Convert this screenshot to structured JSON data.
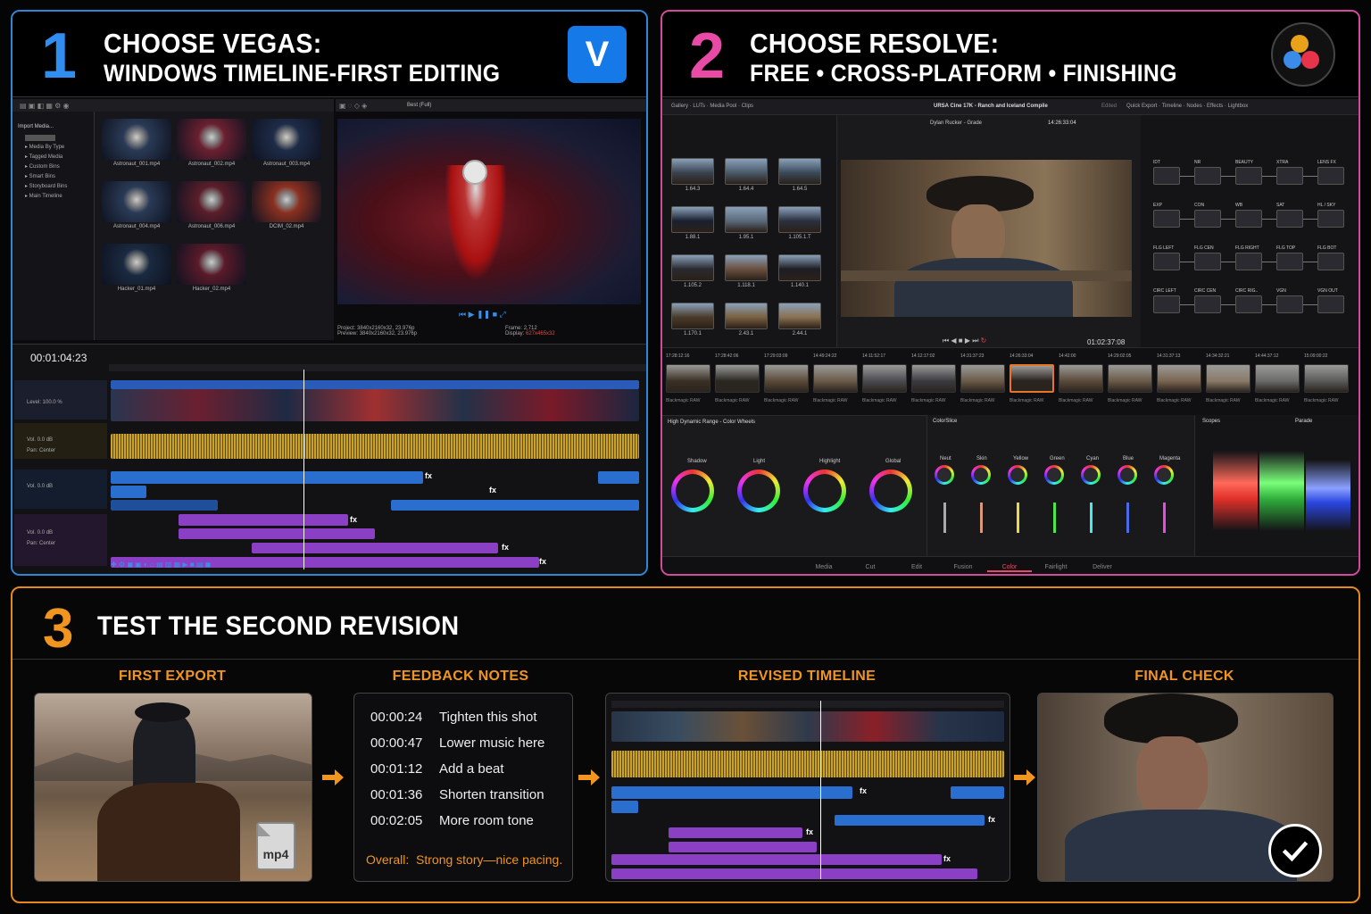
{
  "panel1": {
    "number": "1",
    "title": "CHOOSE VEGAS:",
    "subtitle": "WINDOWS TIMELINE-FIRST EDITING",
    "logo_letter": "V",
    "explorer": {
      "header": "Import Media...",
      "folders": [
        "Media By Type",
        "Tagged Media",
        "Custom Bins",
        "Smart Bins",
        "Storyboard Bins",
        "Main Timeline"
      ]
    },
    "clips": [
      "Astronaut_001.mp4",
      "Astronaut_002.mp4",
      "Astronaut_003.mp4",
      "Astronaut_004.mp4",
      "Astronaut_006.mp4",
      "DCIM_02.mp4",
      "Hacker_01.mp4",
      "Hacker_02.mp4"
    ],
    "preview_quality": "Best (Full)",
    "project_label": "Project:",
    "project_value": "3840x2160x32, 23.976p",
    "preview_label": "Preview:",
    "preview_value": "3840x2160x32, 23.976p",
    "frame_label": "Frame:",
    "frame_value": "2,712",
    "display_label": "Display:",
    "display_value": "627x465x32",
    "timecode": "00:01:04:23",
    "video_track_level": "Level: 100.0 %",
    "audio_vol": "Vol.",
    "audio_vol_value": "0.0 dB",
    "audio_pan": "Pan:",
    "audio_pan_value": "Center",
    "fx_label": "fx"
  },
  "panel2": {
    "number": "2",
    "title": "CHOOSE RESOLVE:",
    "subtitle": "FREE • CROSS-PLATFORM • FINISHING",
    "topbar": [
      "Gallery",
      "LUTs",
      "Media Pool",
      "Clips"
    ],
    "project_name": "URSA Cine 17K - Ranch and Iceland Compile",
    "edited": "Edited",
    "topbar_right": [
      "Quick Export",
      "Timeline",
      "Nodes",
      "Effects",
      "Lightbox"
    ],
    "grade_label": "Dylan Rucker - Grade",
    "viewer_timecode_top": "14:26:33:04",
    "viewer_timecode": "01:02:37:08",
    "gallery_labels": [
      "1.64.3",
      "1.64.4",
      "1.64.5",
      "1.88.1",
      "1.95.1",
      "1.105.1.T",
      "1.105.2",
      "1.118.1",
      "1.140.1",
      "1.170.1",
      "2.43.1",
      "2.44.1"
    ],
    "nodes": [
      "IDT",
      "NR",
      "BEAUTY",
      "XTRA",
      "LENS FX",
      "EXP",
      "CON",
      "WB",
      "SAT",
      "HL / SKY",
      "FLG LEFT",
      "FLG CEN",
      "FLG RIGHT",
      "FLG TOP",
      "FLG BOT",
      "CIRC LEFT",
      "CIRC CEN",
      "CIRC RIG..",
      "VGN",
      "VGN OUT"
    ],
    "strip_timecodes": [
      "17:28:12:16",
      "17:28:42:06",
      "17:29:03:09",
      "14:49:24:22",
      "14:11:52:17",
      "14:12:17:02",
      "14:31:37:23",
      "14:26:33:04",
      "14:42:00",
      "14:29:02:05",
      "14:31:37:13",
      "14:34:32:21",
      "14:44:37:12",
      "15:09:00:22"
    ],
    "strip_label": "Blackmagic RAW",
    "wheels_title": "High Dynamic Range - Color Wheels",
    "wheels": [
      "Shadow",
      "Light",
      "Highlight",
      "Global"
    ],
    "colorslice_title": "ColorSlice",
    "slices": [
      "Neut",
      "Skin",
      "Yellow",
      "Green",
      "Cyan",
      "Blue",
      "Magenta"
    ],
    "scopes_title": "Scopes",
    "scopes_mode": "Parade",
    "pages": [
      "Media",
      "Cut",
      "Edit",
      "Fusion",
      "Color",
      "Fairlight",
      "Deliver"
    ],
    "active_page": "Color"
  },
  "panel3": {
    "number": "3",
    "title": "TEST THE SECOND REVISION",
    "steps": [
      "FIRST EXPORT",
      "FEEDBACK NOTES",
      "REVISED TIMELINE",
      "FINAL CHECK"
    ],
    "file_badge": "mp4",
    "notes": [
      {
        "time": "00:00:24",
        "text": "Tighten this shot"
      },
      {
        "time": "00:00:47",
        "text": "Lower music here"
      },
      {
        "time": "00:01:12",
        "text": "Add a beat"
      },
      {
        "time": "00:01:36",
        "text": "Shorten transition"
      },
      {
        "time": "00:02:05",
        "text": "More room tone"
      }
    ],
    "overall_label": "Overall:",
    "overall_text": "Strong story—nice pacing."
  },
  "colors": {
    "vegas_border": "#2f86d6",
    "resolve_border": "#d24a9c",
    "step_border": "#e58a1a",
    "accent_orange": "#f0951f",
    "audio_yellow": "#c9a227",
    "audio_blue": "#2a6fd0",
    "audio_purple": "#8a3fc4"
  }
}
